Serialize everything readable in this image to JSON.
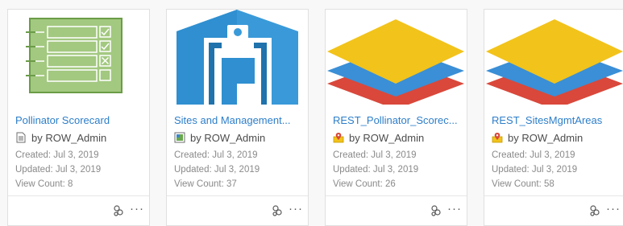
{
  "colors": {
    "link": "#2d7ec9",
    "meta": "#8a8a8a",
    "border": "#e0e0e0"
  },
  "cards": [
    {
      "title": "Pollinator Scorecard",
      "owner": "by ROW_Admin",
      "created": "Created: Jul 3, 2019",
      "updated": "Updated: Jul 3, 2019",
      "views": "View Count: 8",
      "type_icon": "document-icon",
      "thumbnail": "checklist-thumbnail"
    },
    {
      "title": "Sites and Management...",
      "owner": "by ROW_Admin",
      "created": "Created: Jul 3, 2019",
      "updated": "Updated: Jul 3, 2019",
      "views": "View Count: 37",
      "type_icon": "web-app-icon",
      "thumbnail": "clipboard-thumbnail"
    },
    {
      "title": "REST_Pollinator_Scorec...",
      "owner": "by ROW_Admin",
      "created": "Created: Jul 3, 2019",
      "updated": "Updated: Jul 3, 2019",
      "views": "View Count: 26",
      "type_icon": "feature-layer-icon",
      "thumbnail": "layers-thumbnail"
    },
    {
      "title": "REST_SitesMgmtAreas",
      "owner": "by ROW_Admin",
      "created": "Created: Jul 3, 2019",
      "updated": "Updated: Jul 3, 2019",
      "views": "View Count: 58",
      "type_icon": "feature-layer-icon",
      "thumbnail": "layers-thumbnail"
    }
  ],
  "actions": {
    "share_icon": "share-icon",
    "more_icon": "more-options-icon",
    "more_glyph": "···"
  }
}
